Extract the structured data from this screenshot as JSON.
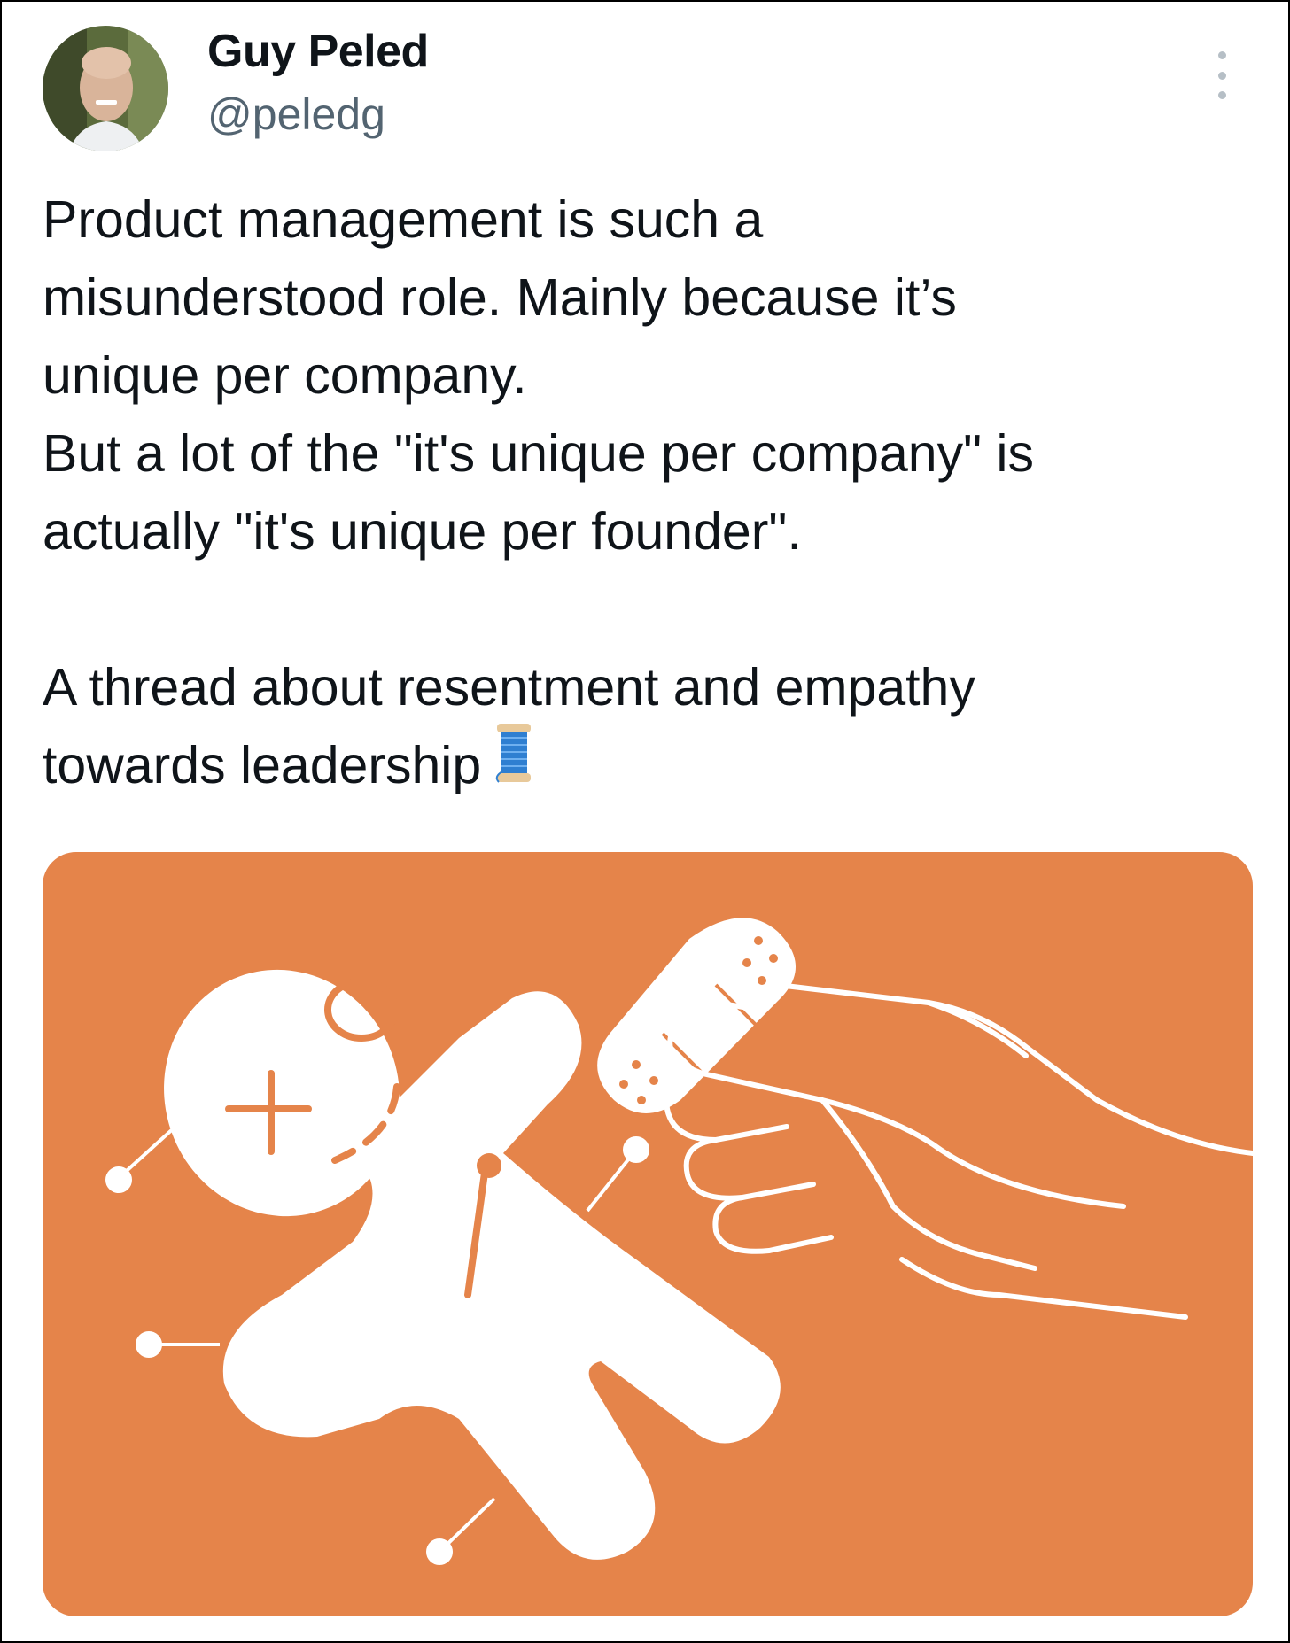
{
  "tweet": {
    "author": {
      "display_name": "Guy Peled",
      "handle": "@peledg",
      "avatar_icon": "profile-photo"
    },
    "more_icon": "more-vertical-icon",
    "text_lines": [
      "Product management is such a",
      "misunderstood role. Mainly because it’s",
      "unique per company.",
      "But a lot of the \"it's unique per company\" is",
      "actually \"it's unique per founder\".",
      "",
      "A thread about resentment and empathy",
      "towards leadership"
    ],
    "thread_emoji": "spool-of-thread-emoji",
    "media": {
      "description_icon": "voodoo-doll-bandage-illustration",
      "background_color": "#e5844a"
    }
  }
}
